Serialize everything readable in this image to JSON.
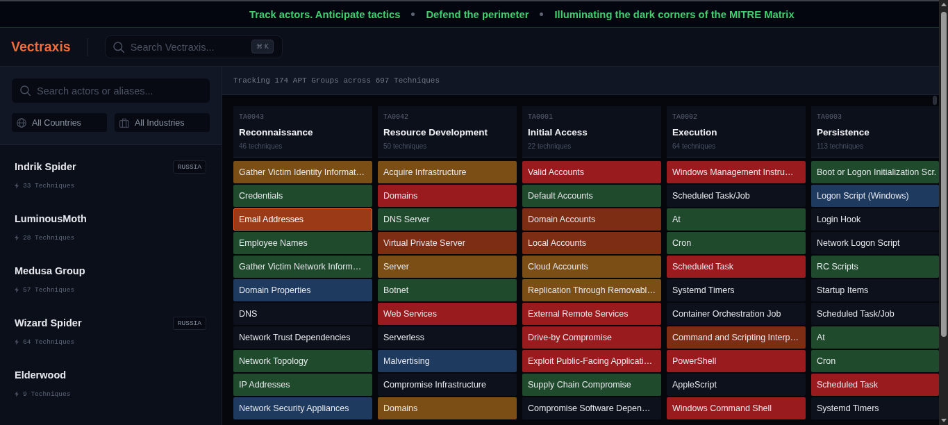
{
  "banner": {
    "phrases": [
      "Track actors. Anticipate tactics",
      "Defend the perimeter",
      "Illuminating the dark corners of the MITRE Matrix"
    ]
  },
  "header": {
    "logo": "Vectraxis",
    "search": {
      "placeholder": "Search Vectraxis...",
      "shortcut": "⌘ K"
    }
  },
  "sidebar": {
    "search": {
      "placeholder": "Search actors or aliases..."
    },
    "filters": {
      "country": "All Countries",
      "industry": "All Industries"
    },
    "actors": [
      {
        "name": "Indrik Spider",
        "techniques": "33 Techniques",
        "country": "RUSSIA"
      },
      {
        "name": "LuminousMoth",
        "techniques": "28 Techniques"
      },
      {
        "name": "Medusa Group",
        "techniques": "57 Techniques"
      },
      {
        "name": "Wizard Spider",
        "techniques": "64 Techniques",
        "country": "RUSSIA"
      },
      {
        "name": "Elderwood",
        "techniques": "9 Techniques"
      }
    ]
  },
  "summary": "Tracking 174 APT Groups across 697 Techniques",
  "matrix": {
    "tactics": [
      {
        "id": "TA0043",
        "name": "Reconnaissance",
        "count": "46 techniques",
        "techniques": [
          {
            "name": "Gather Victim Identity Informat…",
            "color": "#7a4e14",
            "selected": false
          },
          {
            "name": "Credentials",
            "color": "#1f4b2c",
            "selected": false
          },
          {
            "name": "Email Addresses",
            "color": "#9a3a16",
            "selected": true
          },
          {
            "name": "Employee Names",
            "color": "#1f4b2c",
            "selected": false
          },
          {
            "name": "Gather Victim Network Inform…",
            "color": "#1f4b2c",
            "selected": false
          },
          {
            "name": "Domain Properties",
            "color": "#1e3a5f",
            "selected": false
          },
          {
            "name": "DNS",
            "color": "#0d111c",
            "selected": false
          },
          {
            "name": "Network Trust Dependencies",
            "color": "#0d111c",
            "selected": false
          },
          {
            "name": "Network Topology",
            "color": "#1f4b2c",
            "selected": false
          },
          {
            "name": "IP Addresses",
            "color": "#1f4b2c",
            "selected": false
          },
          {
            "name": "Network Security Appliances",
            "color": "#1e3a5f",
            "selected": false
          }
        ]
      },
      {
        "id": "TA0042",
        "name": "Resource Development",
        "count": "50 techniques",
        "techniques": [
          {
            "name": "Acquire Infrastructure",
            "color": "#7a4e14",
            "selected": false
          },
          {
            "name": "Domains",
            "color": "#991b1e",
            "selected": false
          },
          {
            "name": "DNS Server",
            "color": "#1f4b2c",
            "selected": false
          },
          {
            "name": "Virtual Private Server",
            "color": "#7c2d14",
            "selected": false
          },
          {
            "name": "Server",
            "color": "#7a4e14",
            "selected": false
          },
          {
            "name": "Botnet",
            "color": "#1f4b2c",
            "selected": false
          },
          {
            "name": "Web Services",
            "color": "#991b1e",
            "selected": false
          },
          {
            "name": "Serverless",
            "color": "#0d111c",
            "selected": false
          },
          {
            "name": "Malvertising",
            "color": "#1e3a5f",
            "selected": false
          },
          {
            "name": "Compromise Infrastructure",
            "color": "#0d111c",
            "selected": false
          },
          {
            "name": "Domains",
            "color": "#7a4e14",
            "selected": false
          }
        ]
      },
      {
        "id": "TA0001",
        "name": "Initial Access",
        "count": "22 techniques",
        "techniques": [
          {
            "name": "Valid Accounts",
            "color": "#991b1e",
            "selected": false
          },
          {
            "name": "Default Accounts",
            "color": "#1f4b2c",
            "selected": false
          },
          {
            "name": "Domain Accounts",
            "color": "#7c2d14",
            "selected": false
          },
          {
            "name": "Local Accounts",
            "color": "#7c2d14",
            "selected": false
          },
          {
            "name": "Cloud Accounts",
            "color": "#7a4e14",
            "selected": false
          },
          {
            "name": "Replication Through Removabl…",
            "color": "#7a4e14",
            "selected": false
          },
          {
            "name": "External Remote Services",
            "color": "#991b1e",
            "selected": false
          },
          {
            "name": "Drive-by Compromise",
            "color": "#991b1e",
            "selected": false
          },
          {
            "name": "Exploit Public-Facing Applicati…",
            "color": "#991b1e",
            "selected": false
          },
          {
            "name": "Supply Chain Compromise",
            "color": "#1f4b2c",
            "selected": false
          },
          {
            "name": "Compromise Software Depen…",
            "color": "#0d111c",
            "selected": false
          }
        ]
      },
      {
        "id": "TA0002",
        "name": "Execution",
        "count": "64 techniques",
        "techniques": [
          {
            "name": "Windows Management Instru…",
            "color": "#991b1e",
            "selected": false
          },
          {
            "name": "Scheduled Task/Job",
            "color": "#0d111c",
            "selected": false
          },
          {
            "name": "At",
            "color": "#1f4b2c",
            "selected": false
          },
          {
            "name": "Cron",
            "color": "#1f4b2c",
            "selected": false
          },
          {
            "name": "Scheduled Task",
            "color": "#991b1e",
            "selected": false
          },
          {
            "name": "Systemd Timers",
            "color": "#0d111c",
            "selected": false
          },
          {
            "name": "Container Orchestration Job",
            "color": "#0d111c",
            "selected": false
          },
          {
            "name": "Command and Scripting Interp…",
            "color": "#7c2d14",
            "selected": false
          },
          {
            "name": "PowerShell",
            "color": "#991b1e",
            "selected": false
          },
          {
            "name": "AppleScript",
            "color": "#0d111c",
            "selected": false
          },
          {
            "name": "Windows Command Shell",
            "color": "#991b1e",
            "selected": false
          }
        ]
      },
      {
        "id": "TA0003",
        "name": "Persistence",
        "count": "113 techniques",
        "techniques": [
          {
            "name": "Boot or Logon Initialization Scr.",
            "color": "#1f4b2c",
            "selected": false
          },
          {
            "name": "Logon Script (Windows)",
            "color": "#1e3a5f",
            "selected": false
          },
          {
            "name": "Login Hook",
            "color": "#0d111c",
            "selected": false
          },
          {
            "name": "Network Logon Script",
            "color": "#0d111c",
            "selected": false
          },
          {
            "name": "RC Scripts",
            "color": "#1f4b2c",
            "selected": false
          },
          {
            "name": "Startup Items",
            "color": "#0d111c",
            "selected": false
          },
          {
            "name": "Scheduled Task/Job",
            "color": "#0d111c",
            "selected": false
          },
          {
            "name": "At",
            "color": "#1f4b2c",
            "selected": false
          },
          {
            "name": "Cron",
            "color": "#1f4b2c",
            "selected": false
          },
          {
            "name": "Scheduled Task",
            "color": "#991b1e",
            "selected": false
          },
          {
            "name": "Systemd Timers",
            "color": "#0d111c",
            "selected": false
          }
        ]
      }
    ]
  }
}
